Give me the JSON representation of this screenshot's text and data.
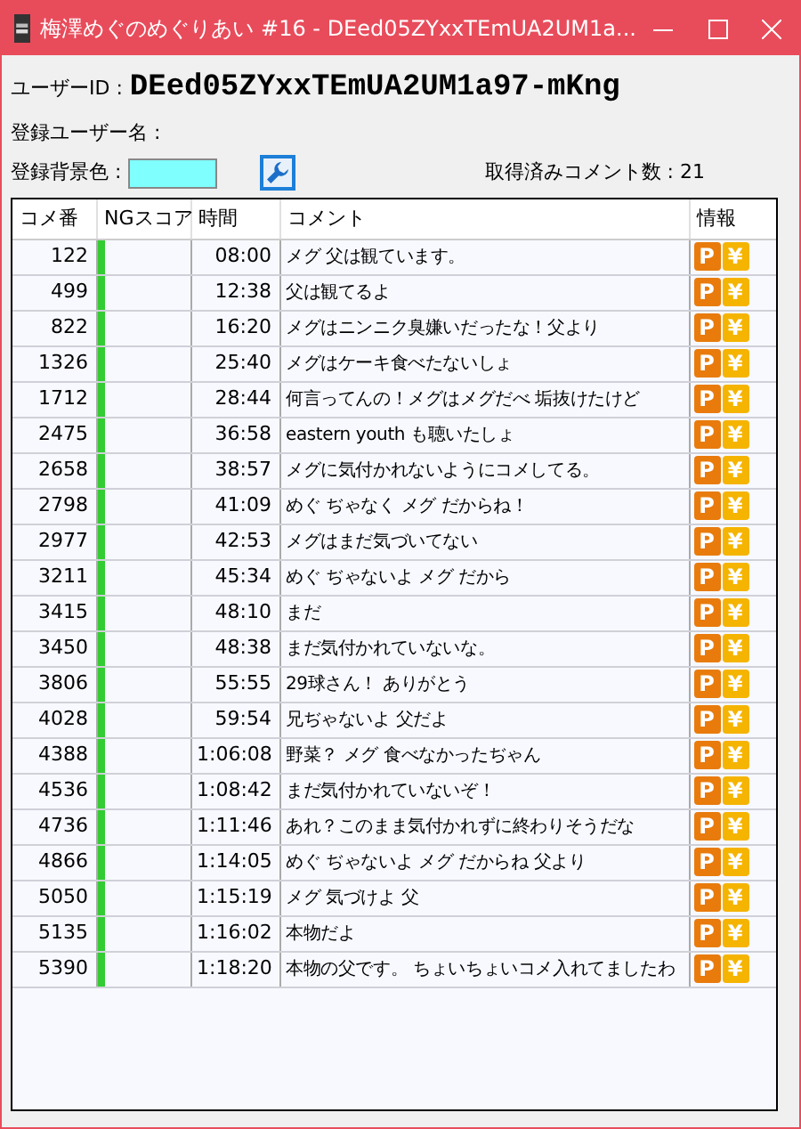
{
  "window": {
    "title": "梅澤めぐのめぐりあい #16 - DEed05ZYxxTEmUA2UM1a..."
  },
  "user_id": {
    "label": "ユーザーID :",
    "value": "DEed05ZYxxTEmUA2UM1a97-mKng"
  },
  "user_name": {
    "label": "登録ユーザー名 :"
  },
  "bg_color": {
    "label": "登録背景色 :",
    "color": "#80ffff"
  },
  "comment_count": {
    "label": "取得済みコメント数 :",
    "value": "21"
  },
  "table": {
    "columns": [
      "コメ番",
      "NGスコア",
      "時間",
      "コメント",
      "情報"
    ],
    "rows": [
      {
        "no": "122",
        "time": "08:00",
        "comment": "メグ 父は観ています。",
        "info": [
          "P",
          "¥"
        ]
      },
      {
        "no": "499",
        "time": "12:38",
        "comment": "父は観てるよ",
        "info": [
          "P",
          "¥"
        ]
      },
      {
        "no": "822",
        "time": "16:20",
        "comment": "メグはニンニク臭嫌いだったな！父より",
        "info": [
          "P",
          "¥"
        ]
      },
      {
        "no": "1326",
        "time": "25:40",
        "comment": "メグはケーキ食べたないしょ",
        "info": [
          "P",
          "¥"
        ]
      },
      {
        "no": "1712",
        "time": "28:44",
        "comment": "何言ってんの！メグはメグだべ 垢抜けたけど",
        "info": [
          "P",
          "¥"
        ]
      },
      {
        "no": "2475",
        "time": "36:58",
        "comment": "eastern youth も聴いたしょ",
        "info": [
          "P",
          "¥"
        ]
      },
      {
        "no": "2658",
        "time": "38:57",
        "comment": "メグに気付かれないようにコメしてる。",
        "info": [
          "P",
          "¥"
        ]
      },
      {
        "no": "2798",
        "time": "41:09",
        "comment": "めぐ ぢゃなく メグ だからね！",
        "info": [
          "P",
          "¥"
        ]
      },
      {
        "no": "2977",
        "time": "42:53",
        "comment": "メグはまだ気づいてない",
        "info": [
          "P",
          "¥"
        ]
      },
      {
        "no": "3211",
        "time": "45:34",
        "comment": "めぐ ぢゃないよ メグ だから",
        "info": [
          "P",
          "¥"
        ]
      },
      {
        "no": "3415",
        "time": "48:10",
        "comment": "まだ",
        "info": [
          "P",
          "¥"
        ]
      },
      {
        "no": "3450",
        "time": "48:38",
        "comment": "まだ気付かれていないな。",
        "info": [
          "P",
          "¥"
        ]
      },
      {
        "no": "3806",
        "time": "55:55",
        "comment": "29球さん！ ありがとう",
        "info": [
          "P",
          "¥"
        ]
      },
      {
        "no": "4028",
        "time": "59:54",
        "comment": "兄ぢゃないよ 父だよ",
        "info": [
          "P",
          "¥"
        ]
      },
      {
        "no": "4388",
        "time": "1:06:08",
        "comment": "野菜？ メグ 食べなかったぢゃん",
        "info": [
          "P",
          "¥"
        ]
      },
      {
        "no": "4536",
        "time": "1:08:42",
        "comment": "まだ気付かれていないぞ！",
        "info": [
          "P",
          "¥"
        ]
      },
      {
        "no": "4736",
        "time": "1:11:46",
        "comment": "あれ？このまま気付かれずに終わりそうだな",
        "info": [
          "P",
          "¥"
        ]
      },
      {
        "no": "4866",
        "time": "1:14:05",
        "comment": "めぐ ぢゃないよ メグ だからね 父より",
        "info": [
          "P",
          "¥"
        ]
      },
      {
        "no": "5050",
        "time": "1:15:19",
        "comment": "メグ 気づけよ 父",
        "info": [
          "P",
          "¥"
        ]
      },
      {
        "no": "5135",
        "time": "1:16:02",
        "comment": "本物だよ",
        "info": [
          "P",
          "¥"
        ]
      },
      {
        "no": "5390",
        "time": "1:18:20",
        "comment": "本物の父です。 ちょいちょいコメ入れてましたわ",
        "info": [
          "P",
          "¥"
        ]
      }
    ]
  }
}
